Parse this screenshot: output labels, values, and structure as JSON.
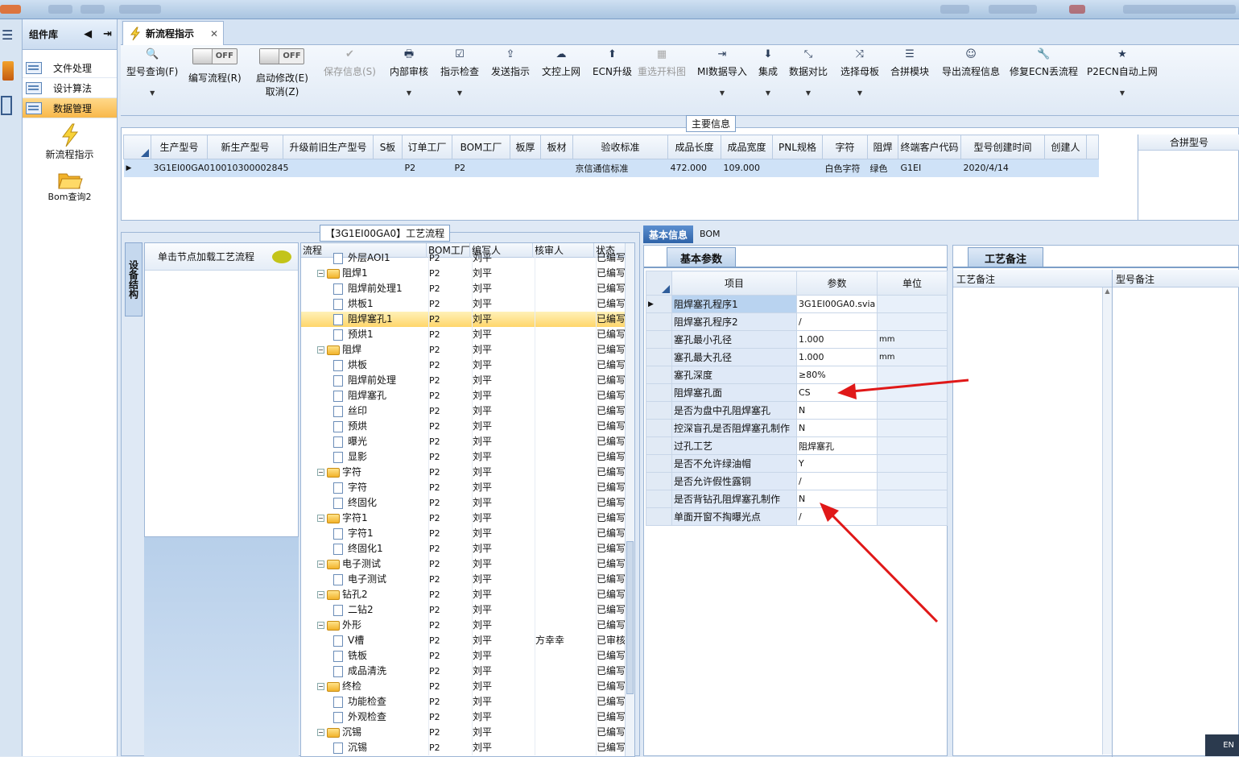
{
  "component_library": {
    "title": "组件库",
    "items": [
      "文件处理",
      "设计算法",
      "数据管理"
    ],
    "big_items": [
      "新流程指示",
      "Bom查询2"
    ]
  },
  "tab": {
    "label": "新流程指示"
  },
  "toolbar": {
    "buttons": [
      {
        "label": "型号查询(F)",
        "icon": "🔍",
        "dd": true
      },
      {
        "label": "编写流程(R)",
        "toggle": "OFF"
      },
      {
        "label": "启动修改(E)",
        "label2": "取消(Z)",
        "toggle": "OFF"
      },
      {
        "label": "保存信息(S)",
        "icon": "✔",
        "disabled": true
      },
      {
        "label": "内部审核",
        "icon": "🖶",
        "dd": true
      },
      {
        "label": "指示检查",
        "icon": "☑",
        "dd": true
      },
      {
        "label": "发送指示",
        "icon": "⇪"
      },
      {
        "label": "文控上网",
        "icon": "☁"
      },
      {
        "label": "ECN升级",
        "icon": "⬆"
      },
      {
        "label": "重选开料图",
        "icon": "▦",
        "disabled": true
      },
      {
        "label": "MI数据导入",
        "icon": "⇥",
        "dd": true
      },
      {
        "label": "集成",
        "icon": "⬇",
        "dd": true
      },
      {
        "label": "数据对比",
        "icon": "⤡",
        "dd": true
      },
      {
        "label": "选择母板",
        "icon": "⤨",
        "dd": true
      },
      {
        "label": "合拼模块",
        "icon": "☰"
      },
      {
        "label": "导出流程信息",
        "icon": "☺"
      },
      {
        "label": "修复ECN丢流程",
        "icon": "🔧"
      },
      {
        "label": "P2ECN自动上网",
        "icon": "★",
        "dd": true
      }
    ]
  },
  "main_info": {
    "caption": "主要信息",
    "columns": [
      "生产型号",
      "新生产型号",
      "升级前旧生产型号",
      "S板",
      "订单工厂",
      "BOM工厂",
      "板厚",
      "板材",
      "验收标准",
      "成品长度",
      "成品宽度",
      "PNL规格",
      "字符",
      "阻焊",
      "终端客户代码",
      "型号创建时间",
      "创建人"
    ],
    "row": [
      "3G1EI00GA0",
      "10010300002845",
      "",
      "",
      "P2",
      "P2",
      "",
      "",
      "京信通信标准",
      "472.000",
      "109.000",
      "",
      "白色字符",
      "绿色",
      "G1EI",
      "2020/4/14",
      ""
    ],
    "merge_label": "合拼型号"
  },
  "process": {
    "caption": "【3G1EI00GA0】工艺流程",
    "side_tab": "设备结构",
    "load_label": "单击节点加载工艺流程",
    "columns": [
      "流程",
      "BOM工厂",
      "编写人",
      "核审人",
      "状态"
    ],
    "rows": [
      {
        "name": "外层AOI1",
        "level": 2,
        "factory": "P2",
        "writer": "刘平",
        "reviewer": "",
        "status": "已编写"
      },
      {
        "name": "阻焊1",
        "level": 1,
        "factory": "P2",
        "writer": "刘平",
        "reviewer": "",
        "status": "已编写"
      },
      {
        "name": "阻焊前处理1",
        "level": 2,
        "factory": "P2",
        "writer": "刘平",
        "reviewer": "",
        "status": "已编写"
      },
      {
        "name": "烘板1",
        "level": 2,
        "factory": "P2",
        "writer": "刘平",
        "reviewer": "",
        "status": "已编写"
      },
      {
        "name": "阻焊塞孔1",
        "level": 2,
        "factory": "P2",
        "writer": "刘平",
        "reviewer": "",
        "status": "已编写",
        "selected": true
      },
      {
        "name": "预烘1",
        "level": 2,
        "factory": "P2",
        "writer": "刘平",
        "reviewer": "",
        "status": "已编写"
      },
      {
        "name": "阻焊",
        "level": 1,
        "factory": "P2",
        "writer": "刘平",
        "reviewer": "",
        "status": "已编写"
      },
      {
        "name": "烘板",
        "level": 2,
        "factory": "P2",
        "writer": "刘平",
        "reviewer": "",
        "status": "已编写"
      },
      {
        "name": "阻焊前处理",
        "level": 2,
        "factory": "P2",
        "writer": "刘平",
        "reviewer": "",
        "status": "已编写"
      },
      {
        "name": "阻焊塞孔",
        "level": 2,
        "factory": "P2",
        "writer": "刘平",
        "reviewer": "",
        "status": "已编写"
      },
      {
        "name": "丝印",
        "level": 2,
        "factory": "P2",
        "writer": "刘平",
        "reviewer": "",
        "status": "已编写"
      },
      {
        "name": "预烘",
        "level": 2,
        "factory": "P2",
        "writer": "刘平",
        "reviewer": "",
        "status": "已编写"
      },
      {
        "name": "曝光",
        "level": 2,
        "factory": "P2",
        "writer": "刘平",
        "reviewer": "",
        "status": "已编写"
      },
      {
        "name": "显影",
        "level": 2,
        "factory": "P2",
        "writer": "刘平",
        "reviewer": "",
        "status": "已编写"
      },
      {
        "name": "字符",
        "level": 1,
        "factory": "P2",
        "writer": "刘平",
        "reviewer": "",
        "status": "已编写"
      },
      {
        "name": "字符",
        "level": 2,
        "factory": "P2",
        "writer": "刘平",
        "reviewer": "",
        "status": "已编写"
      },
      {
        "name": "终固化",
        "level": 2,
        "factory": "P2",
        "writer": "刘平",
        "reviewer": "",
        "status": "已编写"
      },
      {
        "name": "字符1",
        "level": 1,
        "factory": "P2",
        "writer": "刘平",
        "reviewer": "",
        "status": "已编写"
      },
      {
        "name": "字符1",
        "level": 2,
        "factory": "P2",
        "writer": "刘平",
        "reviewer": "",
        "status": "已编写"
      },
      {
        "name": "终固化1",
        "level": 2,
        "factory": "P2",
        "writer": "刘平",
        "reviewer": "",
        "status": "已编写"
      },
      {
        "name": "电子测试",
        "level": 1,
        "factory": "P2",
        "writer": "刘平",
        "reviewer": "",
        "status": "已编写"
      },
      {
        "name": "电子测试",
        "level": 2,
        "factory": "P2",
        "writer": "刘平",
        "reviewer": "",
        "status": "已编写"
      },
      {
        "name": "钻孔2",
        "level": 1,
        "factory": "P2",
        "writer": "刘平",
        "reviewer": "",
        "status": "已编写"
      },
      {
        "name": "二钻2",
        "level": 2,
        "factory": "P2",
        "writer": "刘平",
        "reviewer": "",
        "status": "已编写"
      },
      {
        "name": "外形",
        "level": 1,
        "factory": "P2",
        "writer": "刘平",
        "reviewer": "",
        "status": "已编写"
      },
      {
        "name": "V槽",
        "level": 2,
        "factory": "P2",
        "writer": "刘平",
        "reviewer": "方幸幸",
        "status": "已审核"
      },
      {
        "name": "铣板",
        "level": 2,
        "factory": "P2",
        "writer": "刘平",
        "reviewer": "",
        "status": "已编写"
      },
      {
        "name": "成品清洗",
        "level": 2,
        "factory": "P2",
        "writer": "刘平",
        "reviewer": "",
        "status": "已编写"
      },
      {
        "name": "终检",
        "level": 1,
        "factory": "P2",
        "writer": "刘平",
        "reviewer": "",
        "status": "已编写"
      },
      {
        "name": "功能检查",
        "level": 2,
        "factory": "P2",
        "writer": "刘平",
        "reviewer": "",
        "status": "已编写"
      },
      {
        "name": "外观检查",
        "level": 2,
        "factory": "P2",
        "writer": "刘平",
        "reviewer": "",
        "status": "已编写"
      },
      {
        "name": "沉锡",
        "level": 1,
        "factory": "P2",
        "writer": "刘平",
        "reviewer": "",
        "status": "已编写"
      },
      {
        "name": "沉锡",
        "level": 2,
        "factory": "P2",
        "writer": "刘平",
        "reviewer": "",
        "status": "已编写"
      }
    ]
  },
  "detail": {
    "tabs": [
      "基本信息",
      "BOM"
    ],
    "subtab": "基本参数",
    "columns": [
      "项目",
      "参数",
      "单位"
    ],
    "rows": [
      {
        "item": "阻焊塞孔程序1",
        "param": "3G1EI00GA0.svia",
        "unit": ""
      },
      {
        "item": "阻焊塞孔程序2",
        "param": "/",
        "unit": ""
      },
      {
        "item": "塞孔最小孔径",
        "param": "1.000",
        "unit": "mm"
      },
      {
        "item": "塞孔最大孔径",
        "param": "1.000",
        "unit": "mm"
      },
      {
        "item": "塞孔深度",
        "param": "≥80%",
        "unit": ""
      },
      {
        "item": "阻焊塞孔面",
        "param": "CS",
        "unit": ""
      },
      {
        "item": "是否为盘中孔阻焊塞孔",
        "param": "N",
        "unit": ""
      },
      {
        "item": "控深盲孔是否阻焊塞孔制作",
        "param": "N",
        "unit": ""
      },
      {
        "item": "过孔工艺",
        "param": "阻焊塞孔",
        "unit": ""
      },
      {
        "item": "是否不允许绿油帽",
        "param": "Y",
        "unit": ""
      },
      {
        "item": "是否允许假性露铜",
        "param": "/",
        "unit": ""
      },
      {
        "item": "是否背钻孔阻焊塞孔制作",
        "param": "N",
        "unit": ""
      },
      {
        "item": "单面开窗不掏曝光点",
        "param": "/",
        "unit": ""
      }
    ]
  },
  "remarks": {
    "tab": "工艺备注",
    "col1": "工艺备注",
    "col2": "型号备注"
  },
  "tray": {
    "lang": "EN"
  },
  "colors": {
    "arrow": "#e01818",
    "selection": "#ffd66b",
    "header": "#e1eaf5"
  }
}
